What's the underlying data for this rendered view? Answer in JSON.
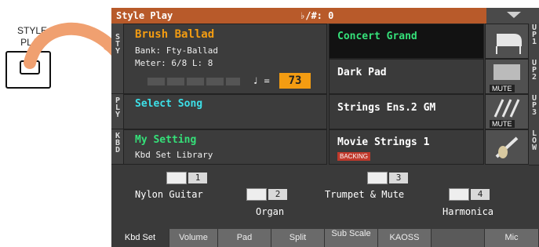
{
  "annotation": {
    "label": "STYLE PLAY"
  },
  "topbar": {
    "title": "Style Play",
    "transpose": "♭/#: 0"
  },
  "side_labels": {
    "style": "STY",
    "play": "PLY",
    "kbd": "KBD",
    "right": [
      "UP1",
      "UP2",
      "UP3",
      "LOW"
    ]
  },
  "style": {
    "name": "Brush Ballad",
    "bank": "Bank: Fty-Ballad",
    "meter": "Meter: 6/8 L:  8",
    "tempo_symbol": "♩ =",
    "tempo": "73"
  },
  "song": {
    "label": "Select Song"
  },
  "setting": {
    "name": "My Setting",
    "sub": "Kbd Set Library"
  },
  "sounds": [
    {
      "name": "Concert Grand",
      "selected": true,
      "mute": ""
    },
    {
      "name": "Dark Pad",
      "selected": false,
      "mute": "MUTE"
    },
    {
      "name": "Strings Ens.2 GM",
      "selected": false,
      "mute": "MUTE"
    },
    {
      "name": "Movie Strings 1",
      "selected": false,
      "badge": "BACKING",
      "mute": ""
    }
  ],
  "pads": [
    {
      "num": "1",
      "name": "Nylon Guitar"
    },
    {
      "num": "2",
      "name": "Organ"
    },
    {
      "num": "3",
      "name": "Trumpet & Mute"
    },
    {
      "num": "4",
      "name": "Harmonica"
    }
  ],
  "tabs": [
    "Kbd Set",
    "Volume",
    "Pad",
    "Split",
    "Sub Scale",
    "KAOSS",
    "",
    "Mic"
  ],
  "colors": {
    "accent": "#f39c12",
    "topbar": "#b85a2a",
    "song": "#3de0e8",
    "setting": "#35e079"
  }
}
